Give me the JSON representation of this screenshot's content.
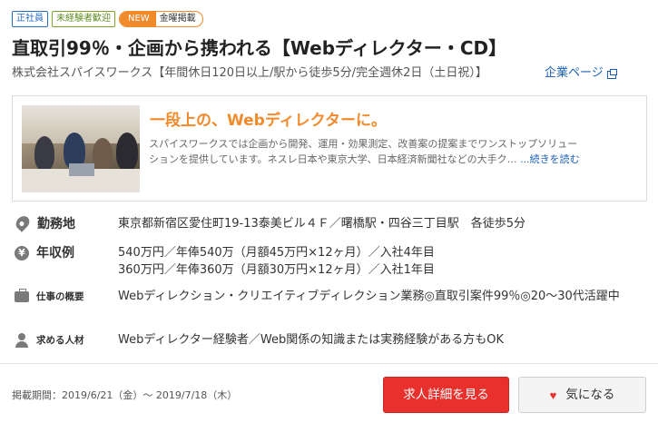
{
  "tags": {
    "employment": "正社員",
    "inexperienced": "未経験者歓迎",
    "new": "NEW",
    "day": "金曜掲載"
  },
  "title": "直取引99％・企画から携われる【Webディレクター・CD】",
  "company": {
    "name": "株式会社スパイスワークス【年間休日120日以上/駅から徒歩5分/完全週休2日（土日祝）】",
    "link_label": "企業ページ",
    "link_icon": "external-link-icon"
  },
  "promo": {
    "heading": "一段上の、Webディレクターに。",
    "text_line1": "スパイスワークスでは企画から開発、運用・効果測定、改善案の提案までワンストップソリュー",
    "text_line2": "ションを提供しています。ネスレ日本や東京大学、日本経済新聞社などの大手ク…",
    "more_label": "...続きを読む"
  },
  "details": {
    "location": {
      "label": "勤務地",
      "value": "東京都新宿区愛住町19-13泰美ビル４Ｆ／曙橋駅・四谷三丁目駅　各徒歩5分",
      "icon": "map-pin-icon"
    },
    "salary": {
      "label": "年収例",
      "value_line1": "540万円／年俸540万（月額45万円×12ヶ月）／入社4年目",
      "value_line2": "360万円／年俸360万（月額30万円×12ヶ月）／入社1年目",
      "icon": "yen-icon"
    },
    "job": {
      "label": "仕事の概要",
      "value": "Webディレクション・クリエイティブディレクション業務◎直取引案件99％◎20〜30代活躍中",
      "icon": "briefcase-icon"
    },
    "requirements": {
      "label": "求める人材",
      "value": "Webディレクター経験者／Web関係の知識または実務経験がある方もOK",
      "icon": "person-icon"
    }
  },
  "footer": {
    "posting_period": "掲載期間：2019/6/21（金）〜 2019/7/18（木）",
    "detail_button": "求人詳細を見る",
    "favorite_button": "気になる",
    "favorite_icon": "heart-icon"
  },
  "colors": {
    "accent_orange": "#f08a2a",
    "primary_red": "#e8302c",
    "link_blue": "#1a5fb4"
  }
}
